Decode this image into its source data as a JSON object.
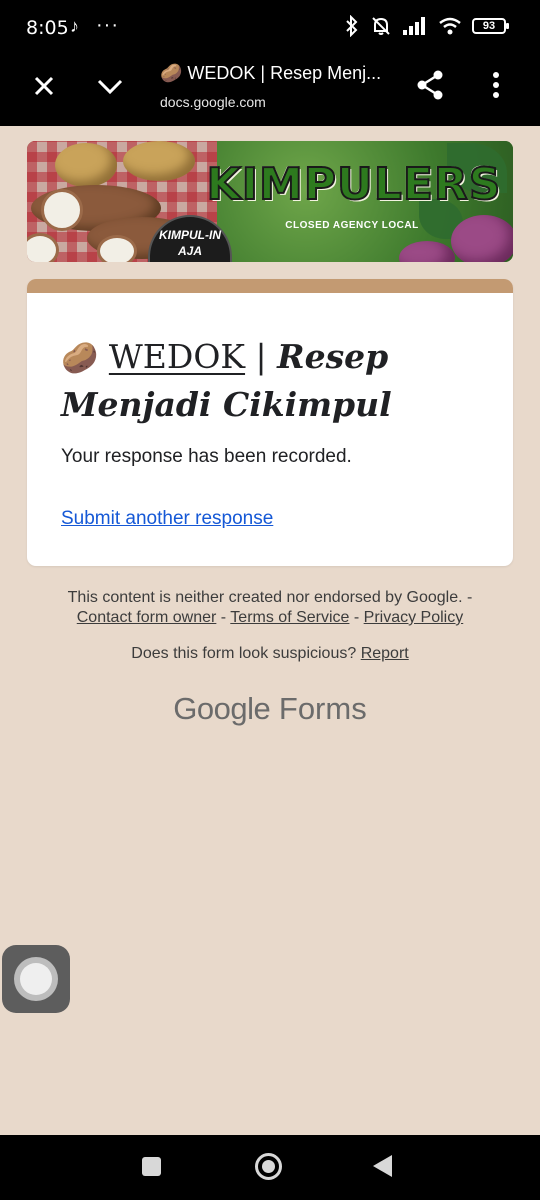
{
  "status_bar": {
    "time": "8:05",
    "tiktok_icon": "♪",
    "more_notifications": "···",
    "battery": "93"
  },
  "browser": {
    "title": "🥔 WEDOK | Resep Menj...",
    "url": "docs.google.com",
    "icons": [
      "close-icon",
      "chevron-down-icon",
      "share-icon",
      "more-vertical-icon"
    ]
  },
  "banner": {
    "title": "KIMPULERS",
    "subtitle": "CLOSED AGENCY LOCAL",
    "badge": "KIMPUL-IN AJA"
  },
  "card": {
    "accent_color": "#c39a72",
    "title_emoji": "🥔",
    "title_main": "WEDOK",
    "title_sep": " | ",
    "title_rest": "Resep Menjadi Cikimpul",
    "message": "Your response has been recorded.",
    "link": "Submit another response"
  },
  "footer": {
    "disclaimer": "This content is neither created nor endorsed by Google. -",
    "contact_link": "Contact form owner",
    "sep1": " - ",
    "terms_link": "Terms of Service",
    "sep2": " - ",
    "privacy_link": "Privacy Policy",
    "suspicious_text": "Does this form look suspicious? ",
    "report_link": "Report",
    "brand_google": "Google",
    "brand_forms": " Forms"
  },
  "nav_bar": {
    "buttons": [
      "recents-square-icon",
      "home-circle-icon",
      "back-triangle-icon"
    ]
  },
  "colors": {
    "page_background": "#e8d9cb",
    "link_blue": "#1558d6"
  }
}
